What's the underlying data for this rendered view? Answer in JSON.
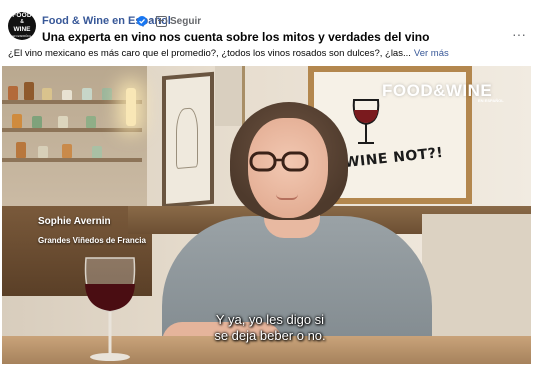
{
  "header": {
    "avatar_text": {
      "line1": "FOOD",
      "line2": "&",
      "line3": "WINE",
      "line4": "EN ESPAÑOL"
    },
    "page_name": "Food & Wine en Español",
    "separator": "·",
    "follow_label": "Seguir",
    "more_options": "···"
  },
  "post": {
    "title": "Una experta en vino nos cuenta sobre los mitos y verdades del vino",
    "description": "¿El vino mexicano es más caro que el promedio?, ¿todos los vinos rosados son dulces?, ¿las...",
    "see_more": "Ver más"
  },
  "video": {
    "brand_logo": "FOOD&WINE",
    "brand_sub": "EN ESPAÑOL",
    "lower_third_name": "Sophie Avernin",
    "lower_third_org": "Grandes Viñedos de Francia",
    "art_text": "WINE NOT?!",
    "subtitle_line1": "Y ya, yo les digo si",
    "subtitle_line2": "se deja beber o no."
  },
  "colors": {
    "link_blue": "#385898",
    "verified_blue": "#1877f2",
    "secondary_text": "#65676b"
  },
  "icons": [
    "verified-badge-icon",
    "follow-icon",
    "more-options-icon"
  ]
}
